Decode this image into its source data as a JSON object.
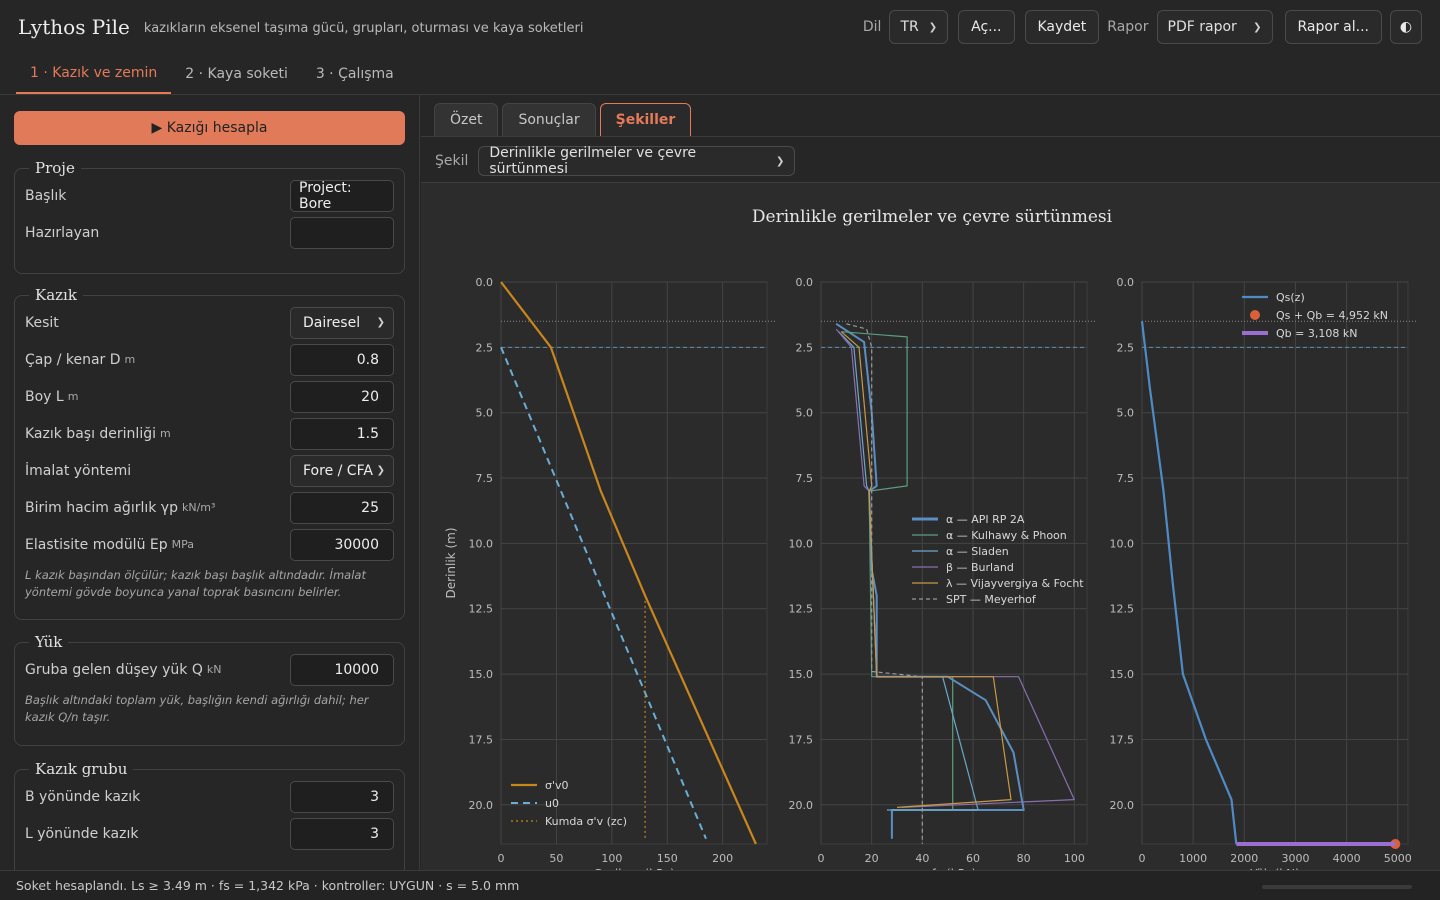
{
  "app": {
    "title": "Lythos Pile",
    "subtitle": "kazıkların eksenel taşıma gücü, grupları, oturması ve kaya soketleri"
  },
  "header": {
    "lang_label": "Dil",
    "lang_value": "TR",
    "open_button": "Aç...",
    "save_button": "Kaydet",
    "report_label": "Rapor",
    "report_format": "PDF rapor",
    "report_button": "Rapor al...",
    "theme_icon": "contrast-icon"
  },
  "steps": [
    {
      "label": "1 · Kazık ve zemin",
      "active": true
    },
    {
      "label": "2 · Kaya soketi",
      "active": false
    },
    {
      "label": "3 · Çalışma",
      "active": false
    }
  ],
  "sidebar": {
    "calc_button": "▶ Kazığı hesapla",
    "project": {
      "title": "Proje",
      "fields": [
        {
          "label": "Başlık",
          "value": "Project: Bore"
        },
        {
          "label": "Hazırlayan",
          "value": ""
        }
      ]
    },
    "pile": {
      "title": "Kazık",
      "fields": [
        {
          "label": "Kesit",
          "unit": "",
          "value": "Dairesel"
        },
        {
          "label": "Çap / kenar D",
          "unit": "m",
          "value": "0.8"
        },
        {
          "label": "Boy L",
          "unit": "m",
          "value": "20"
        },
        {
          "label": "Kazık başı derinliği",
          "unit": "m",
          "value": "1.5"
        },
        {
          "label": "İmalat yöntemi",
          "unit": "",
          "value": "Fore / CFA"
        },
        {
          "label": "Birim hacim ağırlık γp",
          "unit": "kN/m³",
          "value": "25"
        },
        {
          "label": "Elastisite modülü Ep",
          "unit": "MPa",
          "value": "30000"
        }
      ],
      "note": "L kazık başından ölçülür; kazık başı başlık altındadır. İmalat yöntemi gövde boyunca yanal toprak basıncını belirler."
    },
    "load": {
      "title": "Yük",
      "fields": [
        {
          "label": "Gruba gelen düşey yük Q",
          "unit": "kN",
          "value": "10000"
        }
      ],
      "note": "Başlık altındaki toplam yük, başlığın kendi ağırlığı dahil; her kazık Q/n taşır."
    },
    "group": {
      "title": "Kazık grubu",
      "fields": [
        {
          "label": "B yönünde kazık",
          "value": "3"
        },
        {
          "label": "L yönünde kazık",
          "value": "3"
        }
      ]
    }
  },
  "main": {
    "tabs": [
      {
        "label": "Özet",
        "active": false
      },
      {
        "label": "Sonuçlar",
        "active": false
      },
      {
        "label": "Şekiller",
        "active": true
      }
    ],
    "figure_label": "Şekil",
    "figure_select": "Derinlikle gerilmeler ve çevre sürtünmesi"
  },
  "status": {
    "text": "Soket hesaplandı. Ls ≥ 3.49 m · fs = 1,342 kPa · kontroller: UYGUN · s = 5.0 mm"
  },
  "colors": {
    "accent": "#e47a59",
    "stress": "#c8861d",
    "pore": "#6aaed6",
    "api": "#5b8fc4",
    "kulhawy": "#5a9e7f",
    "sladen": "#6aa8c9",
    "burland": "#8a6fb0",
    "vijay": "#c79a45",
    "spt": "#9a9a9a",
    "qs": "#4f8bc4",
    "qb": "#9a6fd1",
    "dot": "#d9603a"
  },
  "chart_data": [
    {
      "type": "line",
      "title": "Derinlikle gerilmeler ve çevre sürtünmesi",
      "ylabel": "Derinlik (m)",
      "xlabel": "Gerilme (kPa)",
      "ylim": [
        0,
        21.5
      ],
      "xlim": [
        0,
        240
      ],
      "yticks": [
        "0.0",
        "2.5",
        "5.0",
        "7.5",
        "10.0",
        "12.5",
        "15.0",
        "17.5",
        "20.0"
      ],
      "xticks": [
        "0",
        "50",
        "100",
        "150",
        "200"
      ],
      "legend": "bottom-left",
      "series": [
        {
          "name": "σ'v0",
          "points": [
            [
              0,
              0
            ],
            [
              45,
              2.5
            ],
            [
              90,
              8
            ],
            [
              130,
              12
            ],
            [
              230,
              21.5
            ]
          ]
        },
        {
          "name": "u0",
          "points": [
            [
              0,
              2.5
            ],
            [
              185,
              21.3
            ]
          ]
        },
        {
          "name": "Kumda σ'v (zc)",
          "points": [
            [
              130,
              12.2
            ],
            [
              130,
              21.3
            ]
          ]
        }
      ]
    },
    {
      "type": "line",
      "xlabel": "fs (kPa)",
      "ylim": [
        0,
        21.5
      ],
      "xlim": [
        0,
        105
      ],
      "yticks": [
        "0.0",
        "2.5",
        "5.0",
        "7.5",
        "10.0",
        "12.5",
        "15.0",
        "17.5",
        "20.0"
      ],
      "xticks": [
        "0",
        "20",
        "40",
        "60",
        "80",
        "100"
      ],
      "legend": "center-right",
      "series": [
        {
          "name": "α — API RP 2A",
          "points": [
            [
              6,
              1.6
            ],
            [
              17,
              2.3
            ],
            [
              20,
              5
            ],
            [
              22,
              7.8
            ],
            [
              19,
              8
            ],
            [
              20,
              11
            ],
            [
              22,
              12
            ],
            [
              22,
              15.1
            ],
            [
              50,
              15.1
            ],
            [
              65,
              16
            ],
            [
              76,
              18
            ],
            [
              80,
              20.2
            ],
            [
              28,
              20.2
            ],
            [
              28,
              21.3
            ]
          ]
        },
        {
          "name": "α — Kulhawy & Phoon",
          "points": [
            [
              8,
              1.9
            ],
            [
              34,
              2.1
            ],
            [
              34,
              7.8
            ],
            [
              19,
              8
            ],
            [
              20,
              15.1
            ],
            [
              52,
              15.1
            ],
            [
              52,
              20.2
            ],
            [
              28,
              20.2
            ]
          ]
        },
        {
          "name": "α — Sladen",
          "points": [
            [
              7,
              1.9
            ],
            [
              13,
              2.5
            ],
            [
              18,
              7.8
            ],
            [
              19,
              8
            ],
            [
              22,
              15.1
            ],
            [
              48,
              15.1
            ],
            [
              62,
              20.2
            ],
            [
              26,
              20.2
            ]
          ]
        },
        {
          "name": "β — Burland",
          "points": [
            [
              6,
              1.8
            ],
            [
              12,
              2.5
            ],
            [
              17,
              7.8
            ],
            [
              19,
              8
            ],
            [
              22,
              15.1
            ],
            [
              78,
              15.1
            ],
            [
              100,
              19.8
            ],
            [
              32,
              20.1
            ]
          ]
        },
        {
          "name": "λ — Vijayvergiya & Focht",
          "points": [
            [
              8,
              1.9
            ],
            [
              15,
              2.5
            ],
            [
              20,
              7.8
            ],
            [
              19,
              8
            ],
            [
              22,
              15.1
            ],
            [
              68,
              15.1
            ],
            [
              75,
              19.8
            ],
            [
              30,
              20.1
            ]
          ]
        },
        {
          "name": "SPT — Meyerhof",
          "points": [
            [
              10,
              1.6
            ],
            [
              18,
              1.8
            ],
            [
              20,
              2.5
            ],
            [
              20,
              14.9
            ],
            [
              40,
              15.1
            ],
            [
              40,
              21.5
            ]
          ]
        }
      ]
    },
    {
      "type": "line",
      "xlabel": "Yük (kN)",
      "ylim": [
        0,
        21.5
      ],
      "xlim": [
        0,
        5200
      ],
      "yticks": [
        "0.0",
        "2.5",
        "5.0",
        "7.5",
        "10.0",
        "12.5",
        "15.0",
        "17.5",
        "20.0"
      ],
      "xticks": [
        "0",
        "1000",
        "2000",
        "3000",
        "4000",
        "5000"
      ],
      "legend": "top-right",
      "series": [
        {
          "name": "Qs(z)",
          "points": [
            [
              0,
              1.5
            ],
            [
              150,
              4
            ],
            [
              420,
              8
            ],
            [
              600,
              11.5
            ],
            [
              800,
              15
            ],
            [
              1250,
              17.5
            ],
            [
              1750,
              19.8
            ],
            [
              1844,
              21.5
            ]
          ]
        },
        {
          "name": "Qs + Qb = 4,952 kN",
          "points": [
            [
              4952,
              21.5
            ]
          ]
        },
        {
          "name": "Qb = 3,108 kN",
          "points": [
            [
              1844,
              21.5
            ],
            [
              4952,
              21.5
            ]
          ]
        }
      ]
    }
  ]
}
